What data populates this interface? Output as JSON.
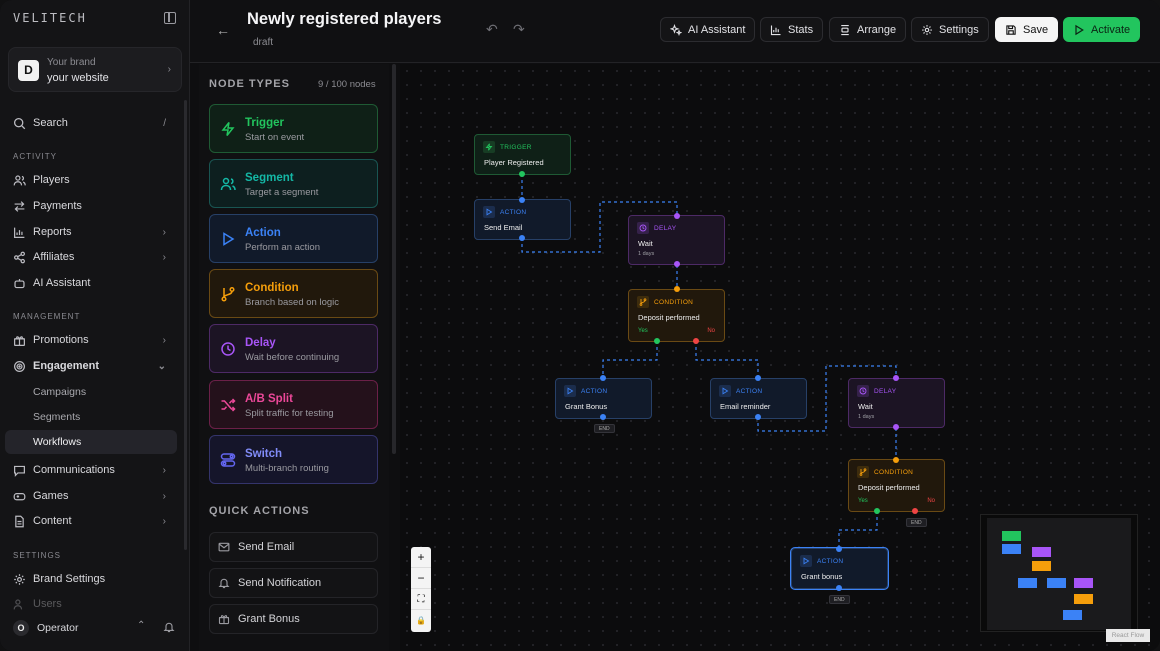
{
  "sidebar": {
    "brand": "VELITECH",
    "brand_card": {
      "logo_letter": "D",
      "line1": "Your brand",
      "line2": "your website"
    },
    "search": {
      "label": "Search",
      "shortcut": "/"
    },
    "sections": {
      "activity": "ACTIVITY",
      "management": "MANAGEMENT",
      "settings": "SETTINGS"
    },
    "activity_items": [
      {
        "label": "Players",
        "icon": "users-icon"
      },
      {
        "label": "Payments",
        "icon": "transfer-icon"
      },
      {
        "label": "Reports",
        "icon": "bar-chart-icon"
      },
      {
        "label": "Affiliates",
        "icon": "share-icon"
      },
      {
        "label": "AI Assistant",
        "icon": "bot-icon"
      }
    ],
    "management_items": [
      {
        "label": "Promotions",
        "icon": "gift-icon"
      },
      {
        "label": "Engagement",
        "icon": "target-icon"
      }
    ],
    "engagement_sub": [
      "Campaigns",
      "Segments",
      "Workflows"
    ],
    "more_items": [
      {
        "label": "Communications",
        "icon": "message-icon"
      },
      {
        "label": "Games",
        "icon": "gamepad-icon"
      },
      {
        "label": "Content",
        "icon": "file-icon"
      }
    ],
    "settings_items": [
      {
        "label": "Brand Settings",
        "icon": "gear-icon"
      },
      {
        "label": "Users",
        "icon": "users-icon"
      }
    ],
    "operator": {
      "initial": "O",
      "label": "Operator"
    }
  },
  "header": {
    "title": "Newly registered players",
    "status": "draft",
    "buttons": {
      "ai": "AI Assistant",
      "stats": "Stats",
      "arrange": "Arrange",
      "settings": "Settings",
      "save": "Save",
      "activate": "Activate"
    }
  },
  "panel": {
    "node_types_title": "NODE TYPES",
    "node_count": "9 / 100 nodes",
    "node_types": [
      {
        "title": "Trigger",
        "desc": "Start on event",
        "color": "#22c55e"
      },
      {
        "title": "Segment",
        "desc": "Target a segment",
        "color": "#14b8a6"
      },
      {
        "title": "Action",
        "desc": "Perform an action",
        "color": "#3b82f6"
      },
      {
        "title": "Condition",
        "desc": "Branch based on logic",
        "color": "#f59e0b"
      },
      {
        "title": "Delay",
        "desc": "Wait before continuing",
        "color": "#a855f7"
      },
      {
        "title": "A/B Split",
        "desc": "Split traffic for testing",
        "color": "#ec4899"
      },
      {
        "title": "Switch",
        "desc": "Multi-branch routing",
        "color": "#6366f1"
      }
    ],
    "quick_actions_title": "QUICK ACTIONS",
    "quick_actions": [
      "Send Email",
      "Send Notification",
      "Grant Bonus"
    ]
  },
  "canvas": {
    "nodes": [
      {
        "kind": "TRIGGER",
        "name": "Player Registered"
      },
      {
        "kind": "ACTION",
        "name": "Send Email"
      },
      {
        "kind": "DELAY",
        "name": "Wait",
        "meta": "1 days"
      },
      {
        "kind": "CONDITION",
        "name": "Deposit performed",
        "yes": "Yes",
        "no": "No"
      },
      {
        "kind": "ACTION",
        "name": "Grant Bonus",
        "end": "END"
      },
      {
        "kind": "ACTION",
        "name": "Email reminder"
      },
      {
        "kind": "DELAY",
        "name": "Wait",
        "meta": "1 days"
      },
      {
        "kind": "CONDITION",
        "name": "Deposit performed",
        "yes": "Yes",
        "no": "No",
        "end": "END"
      },
      {
        "kind": "ACTION",
        "name": "Grant bonus",
        "end": "END"
      }
    ],
    "zoom_controls": [
      "+",
      "−",
      "⛶",
      "🔒"
    ],
    "attribution": "React Flow"
  },
  "colors": {
    "trigger": "#22c55e",
    "action": "#3b82f6",
    "delay": "#a855f7",
    "condition": "#f59e0b",
    "no": "#ef4444"
  }
}
